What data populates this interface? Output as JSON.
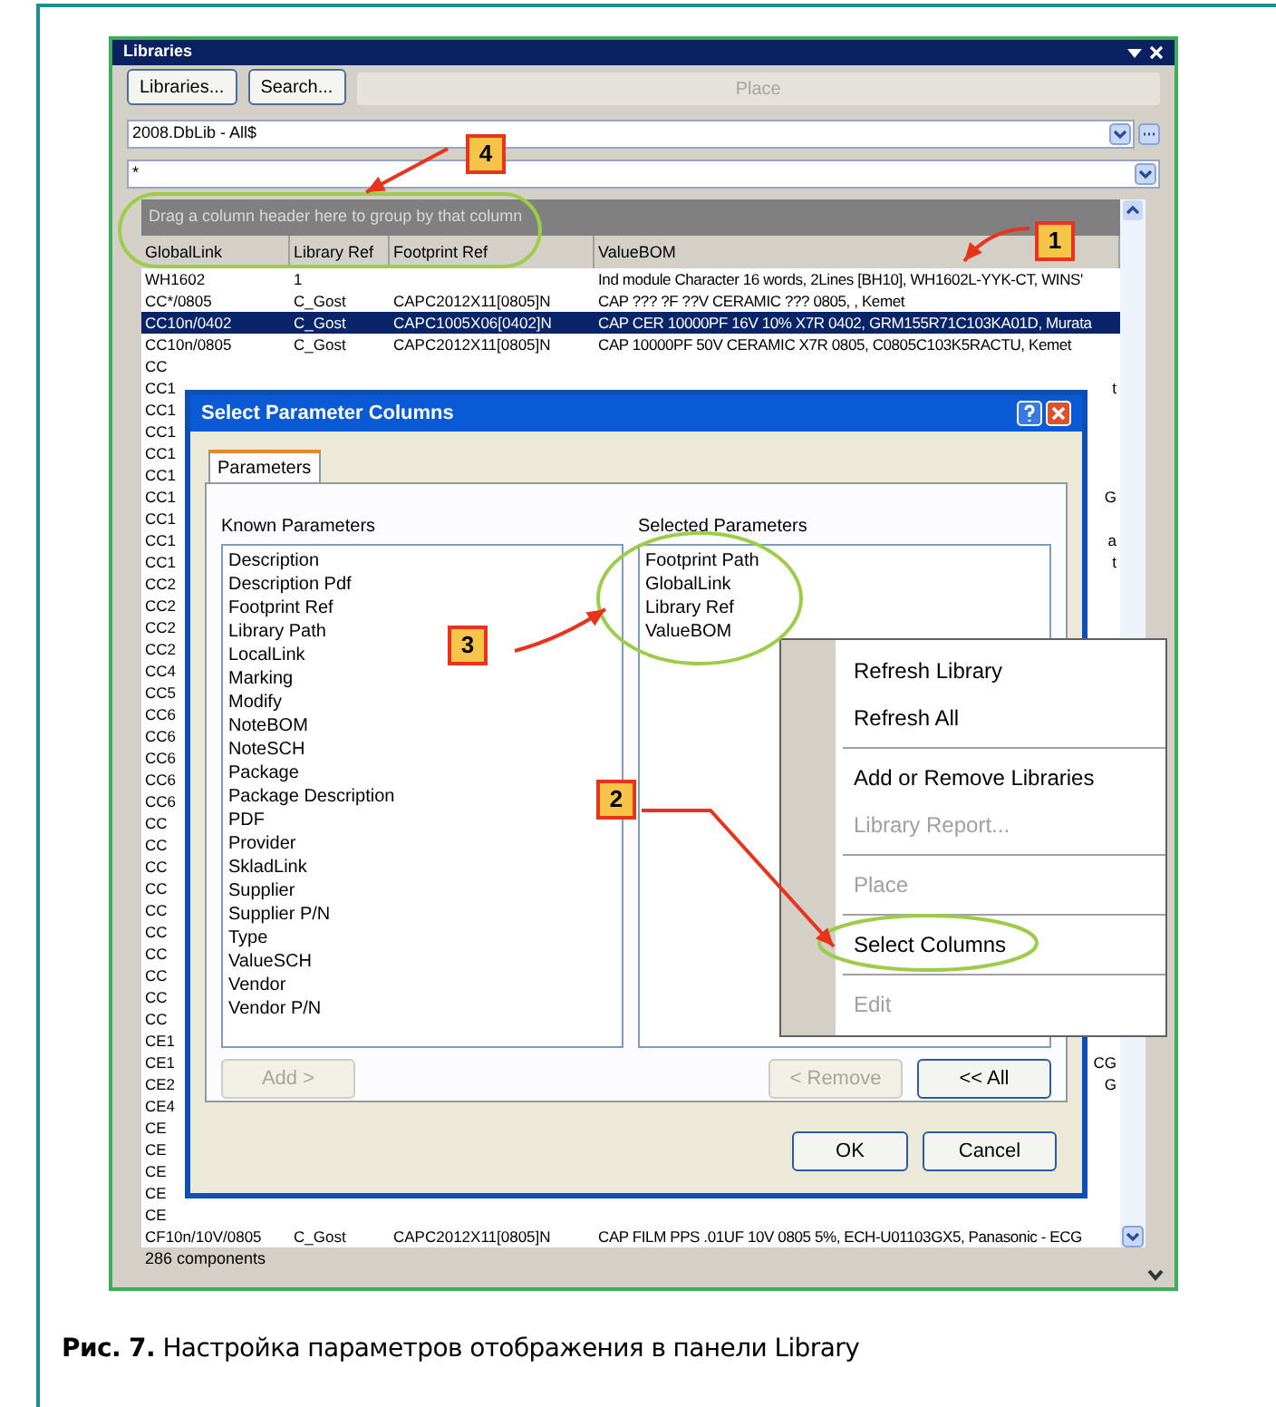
{
  "panel": {
    "title": "Libraries",
    "buttons": [
      "Libraries...",
      "Search..."
    ],
    "place_button": "Place",
    "library_combo": "2008.DbLib - All$",
    "filter_combo": "*",
    "group_hint": "Drag a column header here to group by that column",
    "columns": [
      "GlobalLink",
      "Library Ref",
      "Footprint Ref",
      "ValueBOM"
    ],
    "rows": [
      {
        "global_link": "WH1602",
        "library_ref": "1",
        "value_bom": "Ind module Character 16 words, 2Lines [BH10], WH1602L-YYK-CT, WINS'",
        "selected": false
      },
      {
        "global_link": "CC*/0805",
        "library_ref": "C_Gost",
        "footprint_ref": "CAPC2012X11[0805]N",
        "value_bom": "CAP ??? ?F ??V CERAMIC ??? 0805, , Kemet",
        "selected": false
      },
      {
        "global_link": "CC10n/0402",
        "library_ref": "C_Gost",
        "footprint_ref": "CAPC1005X06[0402]N",
        "value_bom": "CAP CER 10000PF 16V 10% X7R 0402, GRM155R71C103KA01D, Murata",
        "selected": true
      },
      {
        "global_link": "CC10n/0805",
        "library_ref": "C_Gost",
        "footprint_ref": "CAPC2012X11[0805]N",
        "value_bom": "CAP 10000PF 50V CERAMIC X7R 0805, C0805C103K5RACTU, Kemet",
        "selected": false
      }
    ],
    "obscured_rows": [
      {
        "column_1": "CC"
      },
      {
        "column_1": "CC1",
        "column_4": "t"
      },
      {
        "column_1": "CC1"
      },
      {
        "column_1": "CC1"
      },
      {
        "column_1": "CC1"
      },
      {
        "column_1": "CC1"
      },
      {
        "column_1": "CC1",
        "column_4": "G"
      },
      {
        "column_1": "CC1"
      },
      {
        "column_1": "CC1",
        "column_4": "a"
      },
      {
        "column_1": "CC1",
        "column_4": "t"
      },
      {
        "column_1": "CC2"
      },
      {
        "column_1": "CC2"
      },
      {
        "column_1": "CC2"
      },
      {
        "column_1": "CC2"
      },
      {
        "column_1": "CC4"
      },
      {
        "column_1": "CC5"
      },
      {
        "column_1": "CC6"
      },
      {
        "column_1": "CC6"
      },
      {
        "column_1": "CC6"
      },
      {
        "column_1": "CC6"
      },
      {
        "column_1": "CC6"
      },
      {
        "column_1": "CC"
      },
      {
        "column_1": "CC"
      },
      {
        "column_1": "CC"
      },
      {
        "column_1": "CC"
      },
      {
        "column_1": "CC"
      },
      {
        "column_1": "CC"
      },
      {
        "column_1": "CC"
      },
      {
        "column_1": "CC"
      },
      {
        "column_1": "CC"
      },
      {
        "column_1": "CC"
      },
      {
        "column_1": "CE1"
      },
      {
        "column_1": "CE1",
        "column_4": "CG"
      },
      {
        "column_1": "CE2",
        "column_4": "G"
      },
      {
        "column_1": "CE4"
      },
      {
        "column_1": "CE"
      },
      {
        "column_1": "CE"
      },
      {
        "column_1": "CE"
      },
      {
        "column_1": "CE"
      },
      {
        "column_1": "CE"
      }
    ],
    "last_row": {
      "global_link": "CF10n/10V/0805",
      "library_ref": "C_Gost",
      "footprint_ref": "CAPC2012X11[0805]N",
      "value_bom": "CAP FILM PPS .01UF 10V 0805 5%, ECH-U01103GX5, Panasonic - ECG",
      "selected": false
    },
    "status": "286 components"
  },
  "dialog": {
    "title": "Select Parameter Columns",
    "tabs": [
      {
        "label": "Parameters",
        "selected": true
      }
    ],
    "known_label": "Known Parameters",
    "known": [
      "Description",
      "Description Pdf",
      "Footprint Ref",
      "Library Path",
      "LocalLink",
      "Marking",
      "Modify",
      "NoteBOM",
      "NoteSCH",
      "Package",
      "Package Description",
      "PDF",
      "Provider",
      "SkladLink",
      "Supplier",
      "Supplier P/N",
      "Type",
      "ValueSCH",
      "Vendor",
      "Vendor P/N"
    ],
    "selected_label": "Selected Parameters",
    "selected_params": [
      "Footprint Path",
      "GlobalLink",
      "Library Ref",
      "ValueBOM"
    ],
    "add_button": {
      "label": "Add >",
      "disabled": true
    },
    "remove_button": {
      "label": "< Remove",
      "disabled": true
    },
    "all_button": {
      "label": "<< All",
      "disabled": false
    },
    "ok_button": "OK",
    "cancel_button": "Cancel"
  },
  "context_menu": {
    "items": [
      {
        "kind": "item",
        "label": "Refresh Library",
        "disabled": false
      },
      {
        "kind": "item",
        "label": "Refresh All",
        "disabled": false
      },
      {
        "kind": "separator"
      },
      {
        "kind": "item",
        "label": "Add or Remove Libraries",
        "disabled": false
      },
      {
        "kind": "item",
        "label": "Library Report...",
        "disabled": true
      },
      {
        "kind": "separator"
      },
      {
        "kind": "item",
        "label": "Place",
        "disabled": true
      },
      {
        "kind": "separator"
      },
      {
        "kind": "item",
        "label": "Select Columns",
        "disabled": false
      },
      {
        "kind": "separator"
      },
      {
        "kind": "item",
        "label": "Edit",
        "disabled": true
      }
    ]
  },
  "callouts": [
    "4",
    "1",
    "3",
    "2"
  ],
  "caption": {
    "number": "Рис. 7.",
    "text": "Настройка параметров отображения в панели Library"
  }
}
